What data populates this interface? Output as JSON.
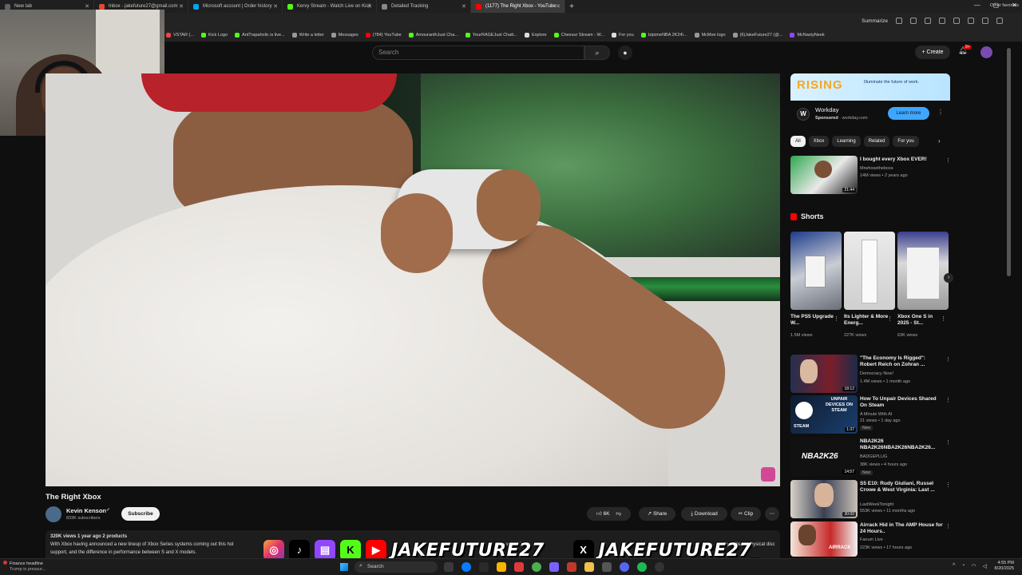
{
  "browser": {
    "tabs": [
      {
        "label": "New tab",
        "color": "#5f6368"
      },
      {
        "label": "Inbox - jakefuture27@gmail.com",
        "color": "#ea4335"
      },
      {
        "label": "Microsoft account | Order history",
        "color": "#00a4ef"
      },
      {
        "label": "Kervy Stream - Watch Live on Kick",
        "color": "#53fc18"
      },
      {
        "label": "Detailed Tracking",
        "color": "#888888"
      },
      {
        "label": "(1177) The Right Xbox - YouTube",
        "color": "#ff0000"
      }
    ],
    "new_tab_symbol": "+",
    "toolbar_summarize": "Summarize",
    "bookmarks": [
      {
        "label": "VSTAR (...",
        "color": "#e44"
      },
      {
        "label": "Kick Logo",
        "color": "#53fc18"
      },
      {
        "label": "AntTrapaholic is live...",
        "color": "#53fc18"
      },
      {
        "label": "Write a letter",
        "color": "#999"
      },
      {
        "label": "Messages",
        "color": "#999"
      },
      {
        "label": "(784) YouTube",
        "color": "#ff0000"
      },
      {
        "label": "AmouranthJust Cha...",
        "color": "#53fc18"
      },
      {
        "label": "YourRAGEJust Chatt...",
        "color": "#53fc18"
      },
      {
        "label": "Explore",
        "color": "#ddd"
      },
      {
        "label": "Cheesur Stream - W...",
        "color": "#53fc18"
      },
      {
        "label": "For you",
        "color": "#ddd"
      },
      {
        "label": "IzipimeNBA 2K24\\...",
        "color": "#53fc18"
      },
      {
        "label": "McMee logo",
        "color": "#999"
      },
      {
        "label": "(6)JakeFuture27 (@...",
        "color": "#999"
      },
      {
        "label": "McNastyNeek",
        "color": "#9146ff"
      }
    ],
    "other_bookmarks": "Other favorites"
  },
  "youtube": {
    "search_placeholder": "Search",
    "create_label": "Create",
    "notif_count": "9+",
    "video": {
      "title": "The Right Xbox",
      "channel": "Kevin Kenson",
      "subscribers": "833K subscribers",
      "subscribe_label": "Subscribe",
      "likes": "6K",
      "share_label": "Share",
      "download_label": "Download",
      "clip_label": "Clip",
      "desc_meta": "320K views  1 year ago  2 products",
      "desc_line1": "With Xbox having announced a new lineup of Xbox Series systems coming out this hol",
      "desc_line1_end": "which Xb",
      "desc_line1_tail": "not you need physical disc",
      "desc_line2": "support, and the difference in performance between S and X models."
    },
    "ad": {
      "banner_word": "RISING",
      "tagline": "Illuminate the future of work.",
      "name": "Workday",
      "sponsored": "Sponsored",
      "domain": "workday.com",
      "logo_letter": "W",
      "cta": "Learn more"
    },
    "chips": [
      "All",
      "Xbox",
      "Learning",
      "Related",
      "For you"
    ],
    "top_rec": {
      "title": "I bought every Xbox EVER!",
      "channel": "Mrwhosetheboss",
      "meta": "14M views • 2 years ago",
      "duration": "21:44"
    },
    "shorts_label": "Shorts",
    "shorts": [
      {
        "title": "The PS5 Upgrade W...",
        "views": "1.5M views"
      },
      {
        "title": "Its Lighter & More Energ...",
        "views": "227K views"
      },
      {
        "title": "Xbox One S in 2025 - St...",
        "views": "63K views"
      }
    ],
    "recs": [
      {
        "title": "\"The Economy Is Rigged\": Robert Reich on Zohran ...",
        "channel": "Democracy Now!",
        "meta": "1.4M views • 1 month ago",
        "duration": "18:12",
        "badge": ""
      },
      {
        "title": "How To Unpair Devices Shared On Steam",
        "channel": "A Minute With AI",
        "meta": "21 views • 1 day ago",
        "duration": "1:37",
        "badge": "New"
      },
      {
        "title": "NBA2K26 NBA2K26NBA2K26NBA2K26...",
        "channel": "BADGEPLUG",
        "meta": "38K views • 4 hours ago",
        "duration": "14:57",
        "badge": "New"
      },
      {
        "title": "S5 E10: Rudy Giuliani, Russel Crowe & West Virginia: Last ...",
        "channel": "LastWeekTonight",
        "meta": "553K views • 11 months ago",
        "duration": "30:00",
        "badge": ""
      },
      {
        "title": "Airrack Hid in The AMP House for 24 Hours..",
        "channel": "Fanum Live",
        "meta": "223K views • 17 hours ago",
        "duration": "",
        "badge": ""
      }
    ],
    "thumb_texts": {
      "steam": "UNPAIR DEVICES ON STEAM",
      "steam_small": "STEAM",
      "nba": "NBA2K26",
      "airrack": "AIRRACK"
    }
  },
  "overlay": {
    "handle_1": "JAKEFUTURE27",
    "handle_2": "JAKEFUTURE27_",
    "x_symbol": "X",
    "k_symbol": "K"
  },
  "taskbar": {
    "news_title": "Finance headline",
    "news_sub": "Trump is pressur...",
    "search_label": "Search",
    "time": "4:55 PM",
    "date": "8/20/2025"
  }
}
